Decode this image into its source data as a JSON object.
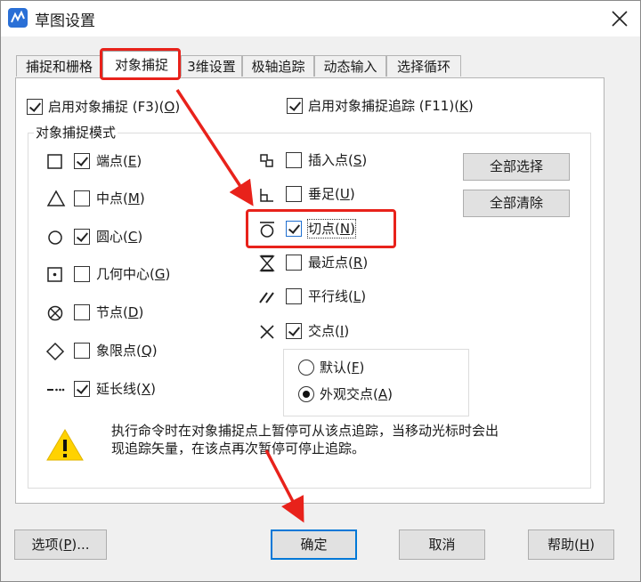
{
  "window": {
    "title": "草图设置"
  },
  "tabs": [
    {
      "label": "捕捉和栅格"
    },
    {
      "label": "对象捕捉"
    },
    {
      "label": "3维设置"
    },
    {
      "label": "极轴追踪"
    },
    {
      "label": "动态输入"
    },
    {
      "label": "选择循环"
    }
  ],
  "top_options": {
    "enable_osnap": {
      "label": "启用对象捕捉 (F3)(",
      "key": "O",
      "end": ")",
      "checked": true
    },
    "enable_tracking": {
      "label": "启用对象捕捉追踪 (F11)(",
      "key": "K",
      "end": ")",
      "checked": true
    }
  },
  "group": {
    "title": "对象捕捉模式"
  },
  "modes_left": [
    {
      "name": "端点",
      "key": "E",
      "checked": true,
      "icon": "square-icon"
    },
    {
      "name": "中点",
      "key": "M",
      "checked": false,
      "icon": "triangle-icon"
    },
    {
      "name": "圆心",
      "key": "C",
      "checked": true,
      "icon": "circle-icon"
    },
    {
      "name": "几何中心",
      "key": "G",
      "checked": false,
      "icon": "square-dot-icon"
    },
    {
      "name": "节点",
      "key": "D",
      "checked": false,
      "icon": "node-icon"
    },
    {
      "name": "象限点",
      "key": "Q",
      "checked": false,
      "icon": "diamond-icon"
    },
    {
      "name": "延长线",
      "key": "X",
      "checked": true,
      "icon": "extension-icon"
    }
  ],
  "modes_right": [
    {
      "name": "插入点",
      "key": "S",
      "checked": false,
      "icon": "insert-icon"
    },
    {
      "name": "垂足",
      "key": "U",
      "checked": false,
      "icon": "perpendicular-icon"
    },
    {
      "name": "切点",
      "key": "N",
      "checked": true,
      "icon": "tangent-icon"
    },
    {
      "name": "最近点",
      "key": "R",
      "checked": false,
      "icon": "hourglass-icon"
    },
    {
      "name": "平行线",
      "key": "L",
      "checked": false,
      "icon": "parallel-icon"
    },
    {
      "name": "交点",
      "key": "I",
      "checked": true,
      "icon": "intersection-icon"
    }
  ],
  "radios": [
    {
      "name": "默认",
      "key": "F",
      "selected": false
    },
    {
      "name": "外观交点",
      "key": "A",
      "selected": true
    }
  ],
  "buttons": {
    "select_all": "全部选择",
    "clear_all": "全部清除",
    "options_prefix": "选项(",
    "options_key": "P",
    "options_suffix": ")...",
    "ok": "确定",
    "cancel": "取消",
    "help_prefix": "帮助(",
    "help_key": "H",
    "help_suffix": ")"
  },
  "info": {
    "line1": "执行命令时在对象捕捉点上暂停可从该点追踪，当移动光标时会出",
    "line2": "现追踪矢量，在该点再次暂停可停止追踪。"
  },
  "colors": {
    "highlight": "#e8221b",
    "accent": "#0078d7",
    "warning": "#ffd200"
  }
}
